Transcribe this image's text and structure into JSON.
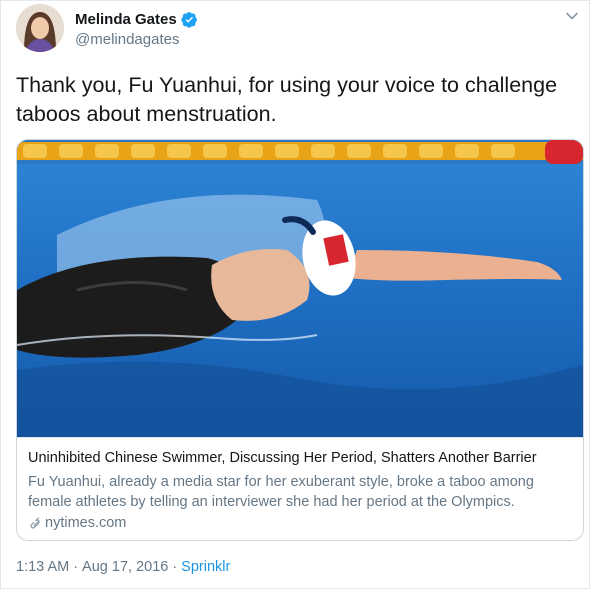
{
  "author": {
    "display_name": "Melinda Gates",
    "handle": "@melindagates",
    "avatar_icon": "profile-photo",
    "verified_icon": "verified-badge-icon"
  },
  "tweet": {
    "text": "Thank you, Fu Yuanhui, for using your voice to challenge taboos about menstruation."
  },
  "card": {
    "image": "swimmer-backstroke-photo",
    "title": "Uninhibited Chinese Swimmer, Discussing Her Period, Shatters Another Barrier",
    "description": "Fu Yuanhui, already a media star for her exuberant style, broke a taboo among female athletes by telling an interviewer she had her period at the Olympics.",
    "domain": "nytimes.com",
    "domain_icon": "link-icon"
  },
  "meta": {
    "time": "1:13 AM",
    "separator1": "·",
    "date": "Aug 17, 2016",
    "separator2": "·",
    "source": "Sprinklr"
  },
  "colors": {
    "text_primary": "#14171a",
    "text_secondary": "#657786",
    "link": "#1b95e0",
    "verified": "#1da1f2",
    "border": "#e1e8ed"
  }
}
